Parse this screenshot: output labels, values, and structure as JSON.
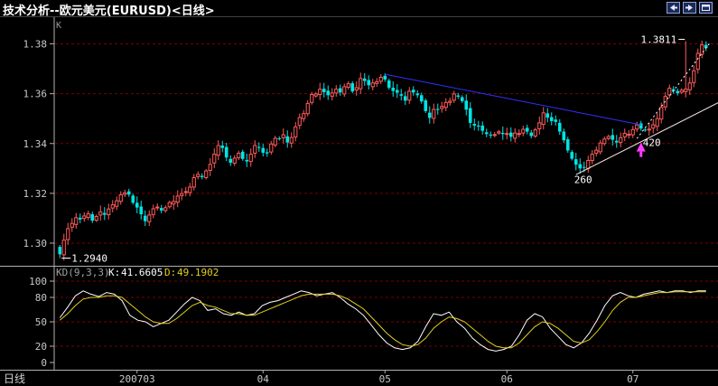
{
  "window": {
    "title": "技术分析--欧元美元(EURUSD)<日线>"
  },
  "colors": {
    "up": "#ff5a5a",
    "down": "#00e4e4",
    "k_line": "#ffffff",
    "d_line": "#e0d020",
    "trend_blue": "#3030ff",
    "trend_white": "#ffffff",
    "arrow": "#ff3cff",
    "grid": "#7a0000",
    "axis": "#b0b0b0"
  },
  "icons": [
    "arrow-left-icon",
    "arrow-right-icon",
    "window-restore-icon"
  ],
  "chart_data": [
    {
      "type": "candlestick",
      "y_axis_label": "K",
      "ylim": [
        1.292,
        1.39
      ],
      "yticks": [
        "1.38",
        "1.36",
        "1.34",
        "1.32",
        "1.30"
      ],
      "ytick_values": [
        1.38,
        1.36,
        1.34,
        1.32,
        1.3
      ],
      "grid": true,
      "xtick_labels": [
        "200703",
        "04",
        "05",
        "06",
        "07"
      ],
      "xtick_bars": [
        19,
        50,
        80,
        110,
        141
      ],
      "n_bars": 160,
      "closes": [
        1.2955,
        1.3012,
        1.3058,
        1.3079,
        1.3102,
        1.3095,
        1.3109,
        1.3118,
        1.309,
        1.3107,
        1.3125,
        1.3114,
        1.3137,
        1.3154,
        1.317,
        1.3194,
        1.3202,
        1.3195,
        1.3162,
        1.3143,
        1.3116,
        1.3088,
        1.3113,
        1.3138,
        1.3145,
        1.3131,
        1.3142,
        1.3163,
        1.3167,
        1.3189,
        1.3199,
        1.3207,
        1.3225,
        1.3263,
        1.3276,
        1.3265,
        1.329,
        1.3316,
        1.3357,
        1.3392,
        1.3382,
        1.3344,
        1.3323,
        1.3341,
        1.3361,
        1.3338,
        1.3328,
        1.3357,
        1.3392,
        1.3384,
        1.3363,
        1.336,
        1.3398,
        1.3421,
        1.3419,
        1.3435,
        1.3404,
        1.3424,
        1.3467,
        1.3504,
        1.352,
        1.3561,
        1.3597,
        1.3599,
        1.3618,
        1.3606,
        1.3594,
        1.3603,
        1.3618,
        1.3605,
        1.3628,
        1.364,
        1.3609,
        1.3624,
        1.3661,
        1.3651,
        1.3634,
        1.3643,
        1.3648,
        1.3666,
        1.3657,
        1.3624,
        1.3611,
        1.3604,
        1.3592,
        1.3572,
        1.361,
        1.3605,
        1.3594,
        1.3569,
        1.353,
        1.3503,
        1.3537,
        1.3535,
        1.3549,
        1.3565,
        1.357,
        1.3599,
        1.3588,
        1.357,
        1.3536,
        1.3483,
        1.3472,
        1.3468,
        1.3451,
        1.3438,
        1.3432,
        1.3436,
        1.3447,
        1.3438,
        1.344,
        1.3427,
        1.3442,
        1.344,
        1.3457,
        1.3448,
        1.343,
        1.3455,
        1.3483,
        1.3523,
        1.3504,
        1.349,
        1.3487,
        1.3448,
        1.3413,
        1.3372,
        1.3339,
        1.3315,
        1.33,
        1.3304,
        1.3332,
        1.3357,
        1.3373,
        1.3402,
        1.3418,
        1.3428,
        1.3415,
        1.3404,
        1.3423,
        1.3441,
        1.3437,
        1.3456,
        1.3475,
        1.346,
        1.3454,
        1.3458,
        1.3475,
        1.35,
        1.3545,
        1.3589,
        1.3622,
        1.3611,
        1.3602,
        1.3614,
        1.3618,
        1.3643,
        1.3692,
        1.3762,
        1.3796,
        1.3784,
        1.3778,
        1.3792,
        1.3784,
        1.379
      ],
      "annotations": [
        {
          "text": "1.2940",
          "bar": 0,
          "value": 1.294
        },
        {
          "text": "1.3811",
          "bar": 154,
          "value": 1.3811
        },
        {
          "text": "260",
          "bar": 127
        },
        {
          "text": "420",
          "bar": 141
        }
      ],
      "trendlines": [
        {
          "name": "upper-trendline",
          "from": [
            80,
            1.3678
          ],
          "to": [
            143,
            1.3475
          ]
        },
        {
          "name": "support-trendline",
          "from": [
            127,
            1.3275
          ],
          "to": [
            190,
            1.3795
          ]
        },
        {
          "name": "dotted-trendline",
          "from": [
            142,
            1.342
          ],
          "to": [
            160,
            1.3805
          ]
        }
      ],
      "marker": {
        "name": "up-arrow",
        "bar": 143,
        "value": 1.3375
      }
    },
    {
      "type": "line",
      "indicator": "KD(9,3,3)",
      "k_label": "K:",
      "k_value": "41.6605",
      "d_label": "D:",
      "d_value": "49.1902",
      "ylim": [
        0,
        100
      ],
      "yticks": [
        "100",
        "80",
        "50",
        "20",
        "0"
      ],
      "ytick_values": [
        100,
        80,
        50,
        20,
        0
      ],
      "series": [
        {
          "name": "K",
          "values": [
            55,
            68,
            82,
            88,
            84,
            81,
            86,
            84,
            76,
            58,
            52,
            50,
            44,
            48,
            52,
            62,
            72,
            80,
            76,
            64,
            66,
            60,
            58,
            62,
            58,
            60,
            70,
            74,
            76,
            80,
            84,
            88,
            86,
            82,
            84,
            86,
            80,
            72,
            66,
            58,
            46,
            34,
            24,
            18,
            16,
            18,
            26,
            44,
            60,
            58,
            62,
            50,
            42,
            30,
            22,
            16,
            14,
            16,
            20,
            34,
            52,
            60,
            56,
            42,
            32,
            22,
            18,
            24,
            36,
            52,
            70,
            82,
            86,
            82,
            80,
            84,
            86,
            88,
            86,
            88,
            88,
            86,
            88,
            88
          ]
        },
        {
          "name": "D",
          "values": [
            52,
            60,
            70,
            78,
            80,
            80,
            82,
            82,
            80,
            72,
            64,
            56,
            50,
            48,
            48,
            54,
            62,
            70,
            74,
            70,
            68,
            64,
            60,
            60,
            58,
            58,
            62,
            66,
            70,
            74,
            78,
            82,
            84,
            84,
            84,
            84,
            82,
            78,
            72,
            66,
            56,
            46,
            36,
            28,
            22,
            20,
            22,
            30,
            42,
            50,
            56,
            54,
            50,
            42,
            34,
            26,
            20,
            18,
            18,
            24,
            34,
            44,
            50,
            48,
            42,
            34,
            26,
            24,
            28,
            38,
            50,
            64,
            74,
            80,
            80,
            82,
            84,
            86,
            86,
            87,
            87,
            87,
            87,
            87
          ]
        }
      ]
    }
  ],
  "footer": {
    "period_label": "日线"
  }
}
